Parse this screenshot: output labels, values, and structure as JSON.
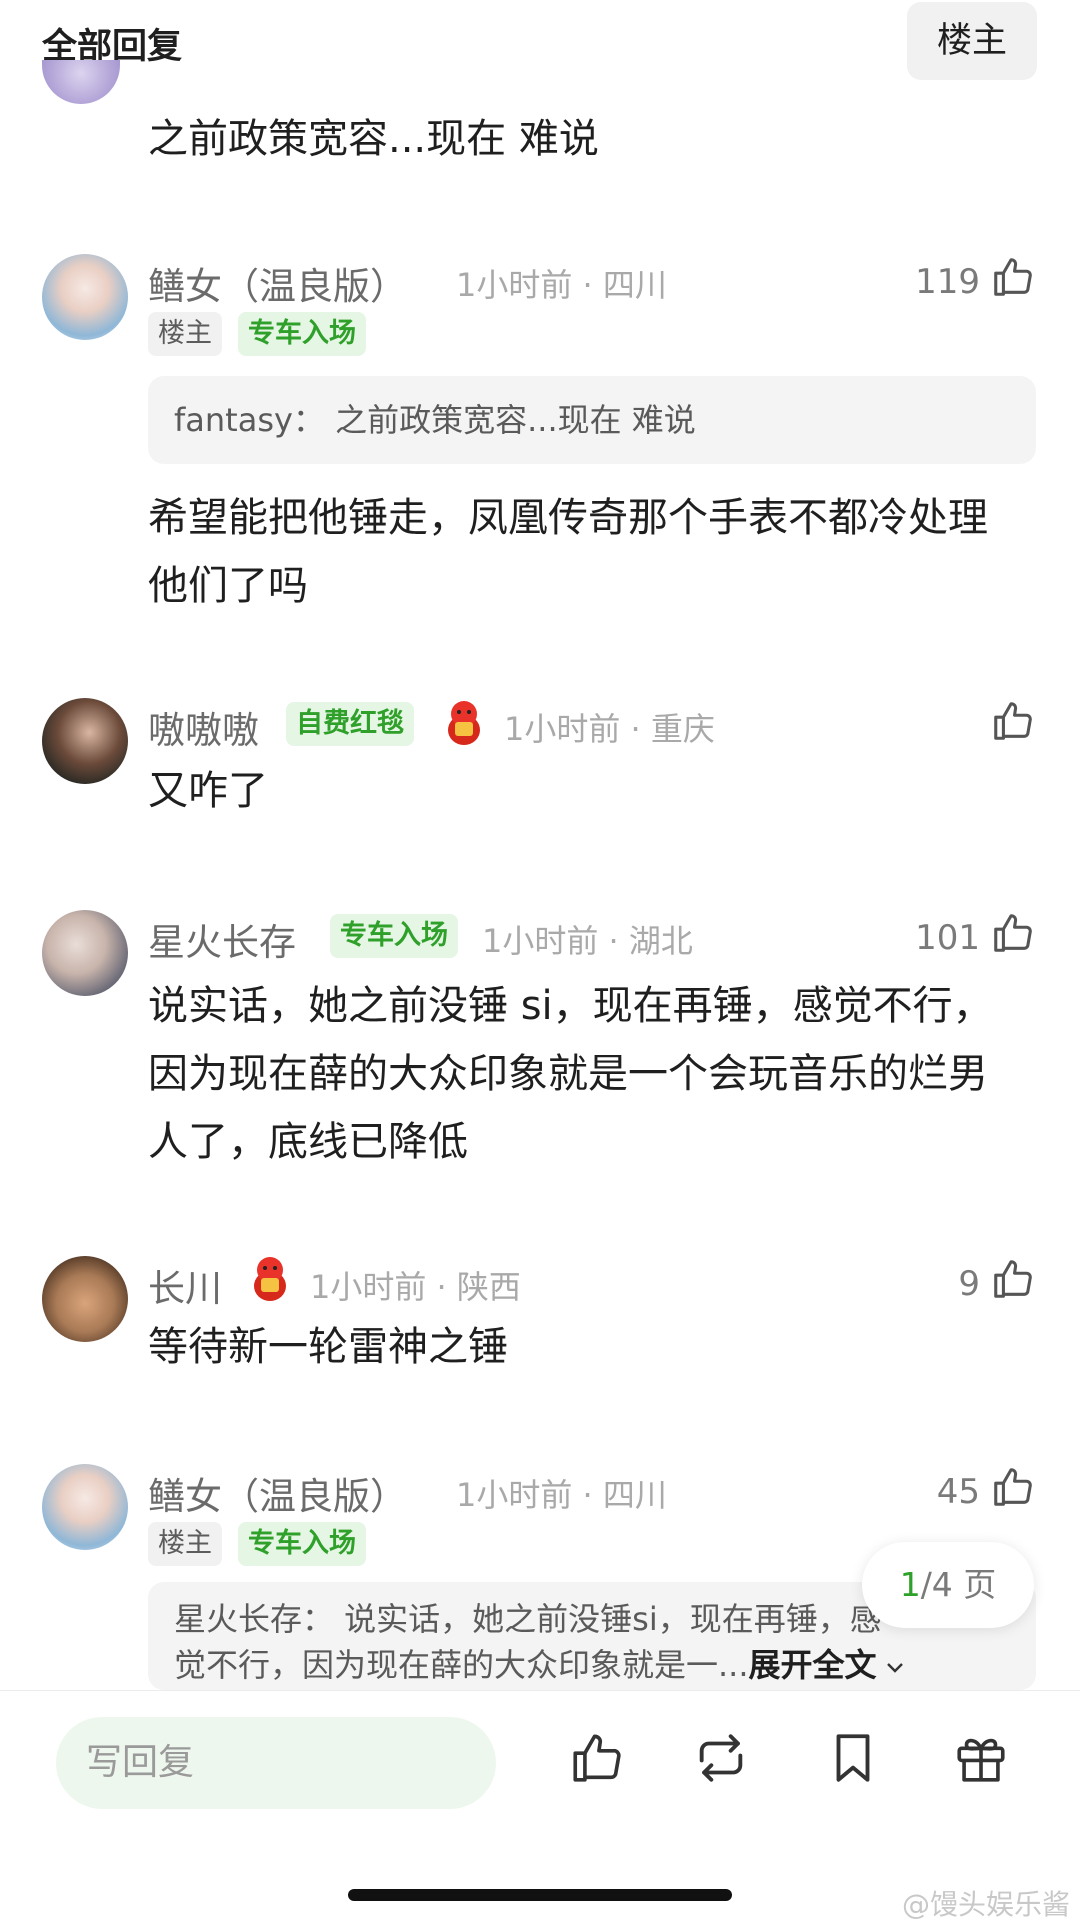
{
  "header": {
    "title": "全部回复",
    "op_button": "楼主"
  },
  "comments": [
    {
      "content": "之前政策宽容...现在 难说"
    },
    {
      "name": "鳝女（温良版）",
      "meta": "1小时前 · 四川",
      "likes": "119",
      "tags": [
        "楼主",
        "专车入场"
      ],
      "quote": "fantasy：  之前政策宽容...现在 难说",
      "content": "希望能把他锤走，凤凰传奇那个手表不都冷处理他们了吗"
    },
    {
      "name": "嗷嗷嗷",
      "tag": "自费红毯",
      "meta": "1小时前 · 重庆",
      "likes": "",
      "content": "又咋了"
    },
    {
      "name": "星火长存",
      "tag": "专车入场",
      "meta": "1小时前 · 湖北",
      "likes": "101",
      "content": "说实话，她之前没锤 si，现在再锤，感觉不行，因为现在薛的大众印象就是一个会玩音乐的烂男人了，底线已降低"
    },
    {
      "name": "长川",
      "meta": "1小时前 · 陕西",
      "likes": "9",
      "content": "等待新一轮雷神之锤"
    },
    {
      "name": "鳝女（温良版）",
      "meta": "1小时前 · 四川",
      "likes": "45",
      "tags": [
        "楼主",
        "专车入场"
      ],
      "quote_line1": "星火长存：  说实话，她之前没锤si，现在再锤，感",
      "quote_line2": "觉不行，因为现在薛的大众印象就是一...",
      "expand": "展开全文"
    }
  ],
  "pager": {
    "current": "1",
    "total": "/4 页"
  },
  "bottom_bar": {
    "reply_placeholder": "写回复"
  },
  "watermark": "@馒头娱乐酱",
  "icons": [
    "thumbs-up-icon",
    "repost-icon",
    "bookmark-icon",
    "gift-icon",
    "chevron-down-icon"
  ],
  "colors": {
    "accent_green": "#2fa02a",
    "tag_green_bg": "#e6f6e4",
    "reply_bg": "#eef7ee"
  }
}
